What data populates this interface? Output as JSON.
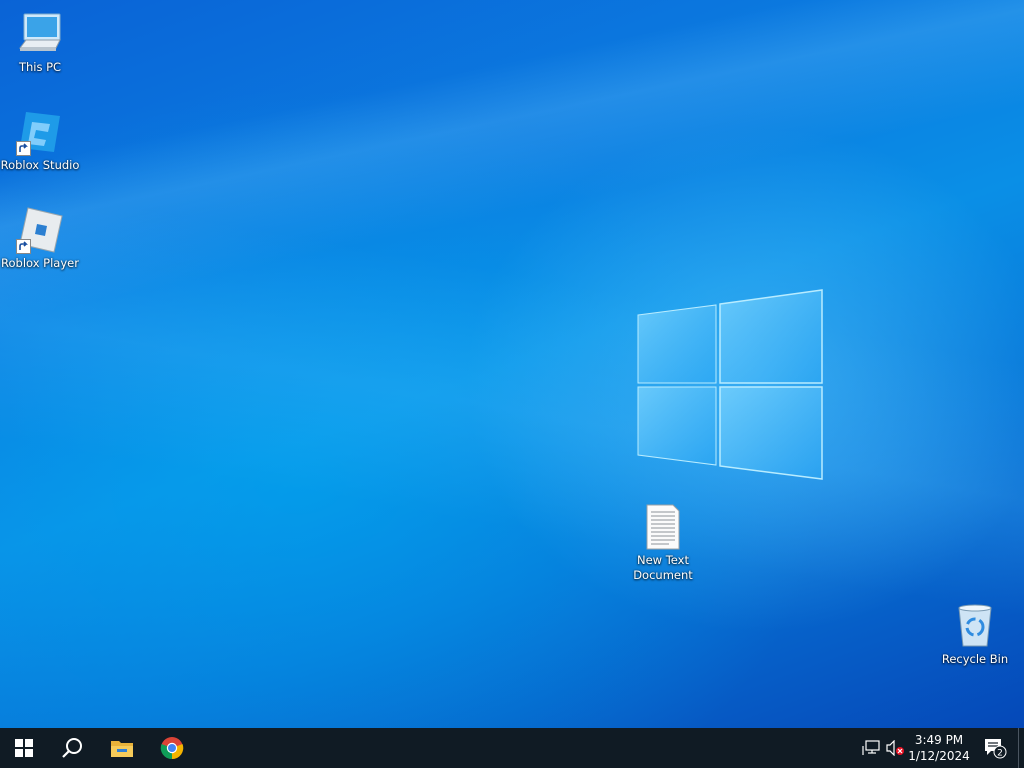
{
  "desktop": {
    "icons": [
      {
        "label": "This PC",
        "icon": "computer-icon",
        "shortcut": false
      },
      {
        "label": "Roblox Studio",
        "icon": "roblox-studio-icon",
        "shortcut": true
      },
      {
        "label": "Roblox Player",
        "icon": "roblox-player-icon",
        "shortcut": true
      },
      {
        "label": "New Text Document",
        "icon": "text-document-icon",
        "shortcut": false
      },
      {
        "label": "Recycle Bin",
        "icon": "recycle-bin-icon",
        "shortcut": false
      }
    ]
  },
  "taskbar": {
    "start": {
      "icon": "windows-start-icon"
    },
    "search": {
      "icon": "search-icon"
    },
    "pinned": [
      {
        "name": "File Explorer",
        "icon": "folder-icon"
      },
      {
        "name": "Google Chrome",
        "icon": "chrome-icon"
      }
    ],
    "tray": {
      "network_icon": "network-disconnected-icon",
      "volume_icon": "volume-muted-icon",
      "time": "3:49 PM",
      "date": "1/12/2024",
      "notifications_count": "2",
      "notifications_icon": "action-center-icon"
    }
  },
  "colors": {
    "taskbar_bg": "#101b24",
    "desktop_accent": "#0a8fe6"
  }
}
